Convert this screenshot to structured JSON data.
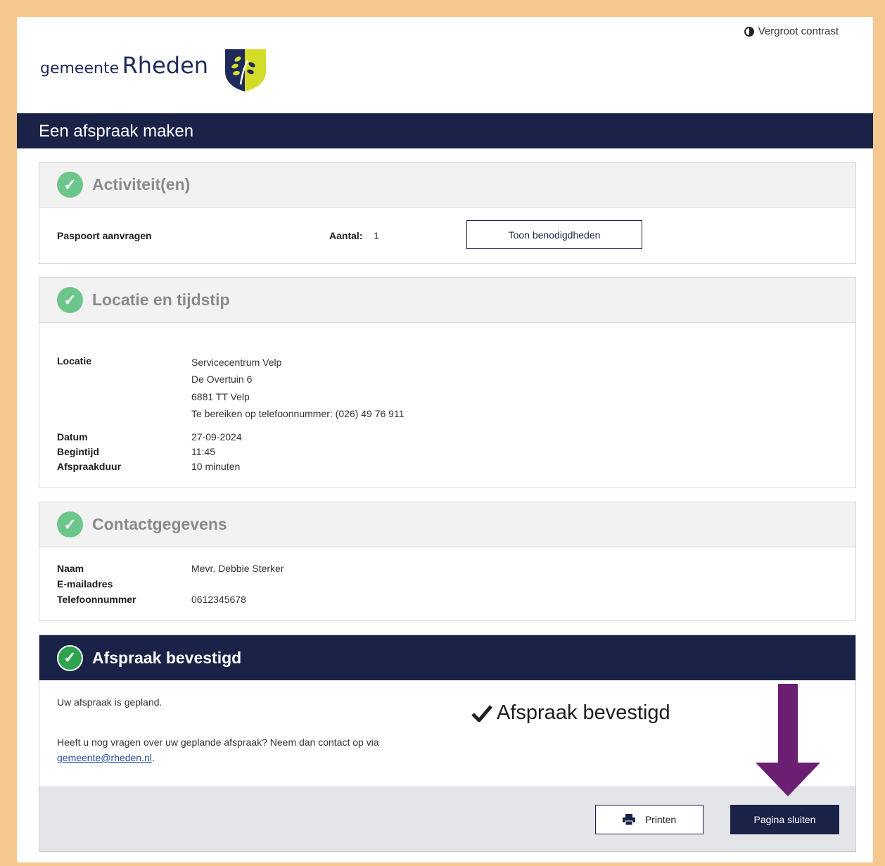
{
  "header": {
    "contrast_label": "Vergroot contrast",
    "logo_small": "gemeente",
    "logo_big": "Rheden",
    "page_title": "Een afspraak maken"
  },
  "activities": {
    "title": "Activiteit(en)",
    "item": "Paspoort aanvragen",
    "count_label": "Aantal:",
    "count_value": "1",
    "requirements_button": "Toon benodigdheden"
  },
  "location": {
    "title": "Locatie en tijdstip",
    "location_label": "Locatie",
    "location_lines": [
      "Servicecentrum Velp",
      "De Overtuin 6",
      "6881 TT Velp",
      "Te bereiken op telefoonnummer: (026) 49 76 911"
    ],
    "date_label": "Datum",
    "date_value": "27-09-2024",
    "start_label": "Begintijd",
    "start_value": "11:45",
    "duration_label": "Afspraakduur",
    "duration_value": "10 minuten"
  },
  "contact": {
    "title": "Contactgegevens",
    "name_label": "Naam",
    "name_value": "Mevr. Debbie Sterker",
    "email_label": "E-mailadres",
    "phone_label": "Telefoonnummer",
    "phone_value": "0612345678"
  },
  "confirmation": {
    "title": "Afspraak bevestigd",
    "planned_text": "Uw afspraak is gepland.",
    "question_text": "Heeft u nog vragen over uw geplande afspraak? Neem dan contact op via",
    "email_link": "gemeente@rheden.nl",
    "period": ".",
    "big_confirm": "Afspraak bevestigd",
    "print_button": "Printen",
    "close_button": "Pagina sluiten"
  },
  "colors": {
    "navy": "#1a2247",
    "success_green": "#6cc58a",
    "frame": "#f5c88f",
    "arrow_purple": "#6b1f73"
  }
}
